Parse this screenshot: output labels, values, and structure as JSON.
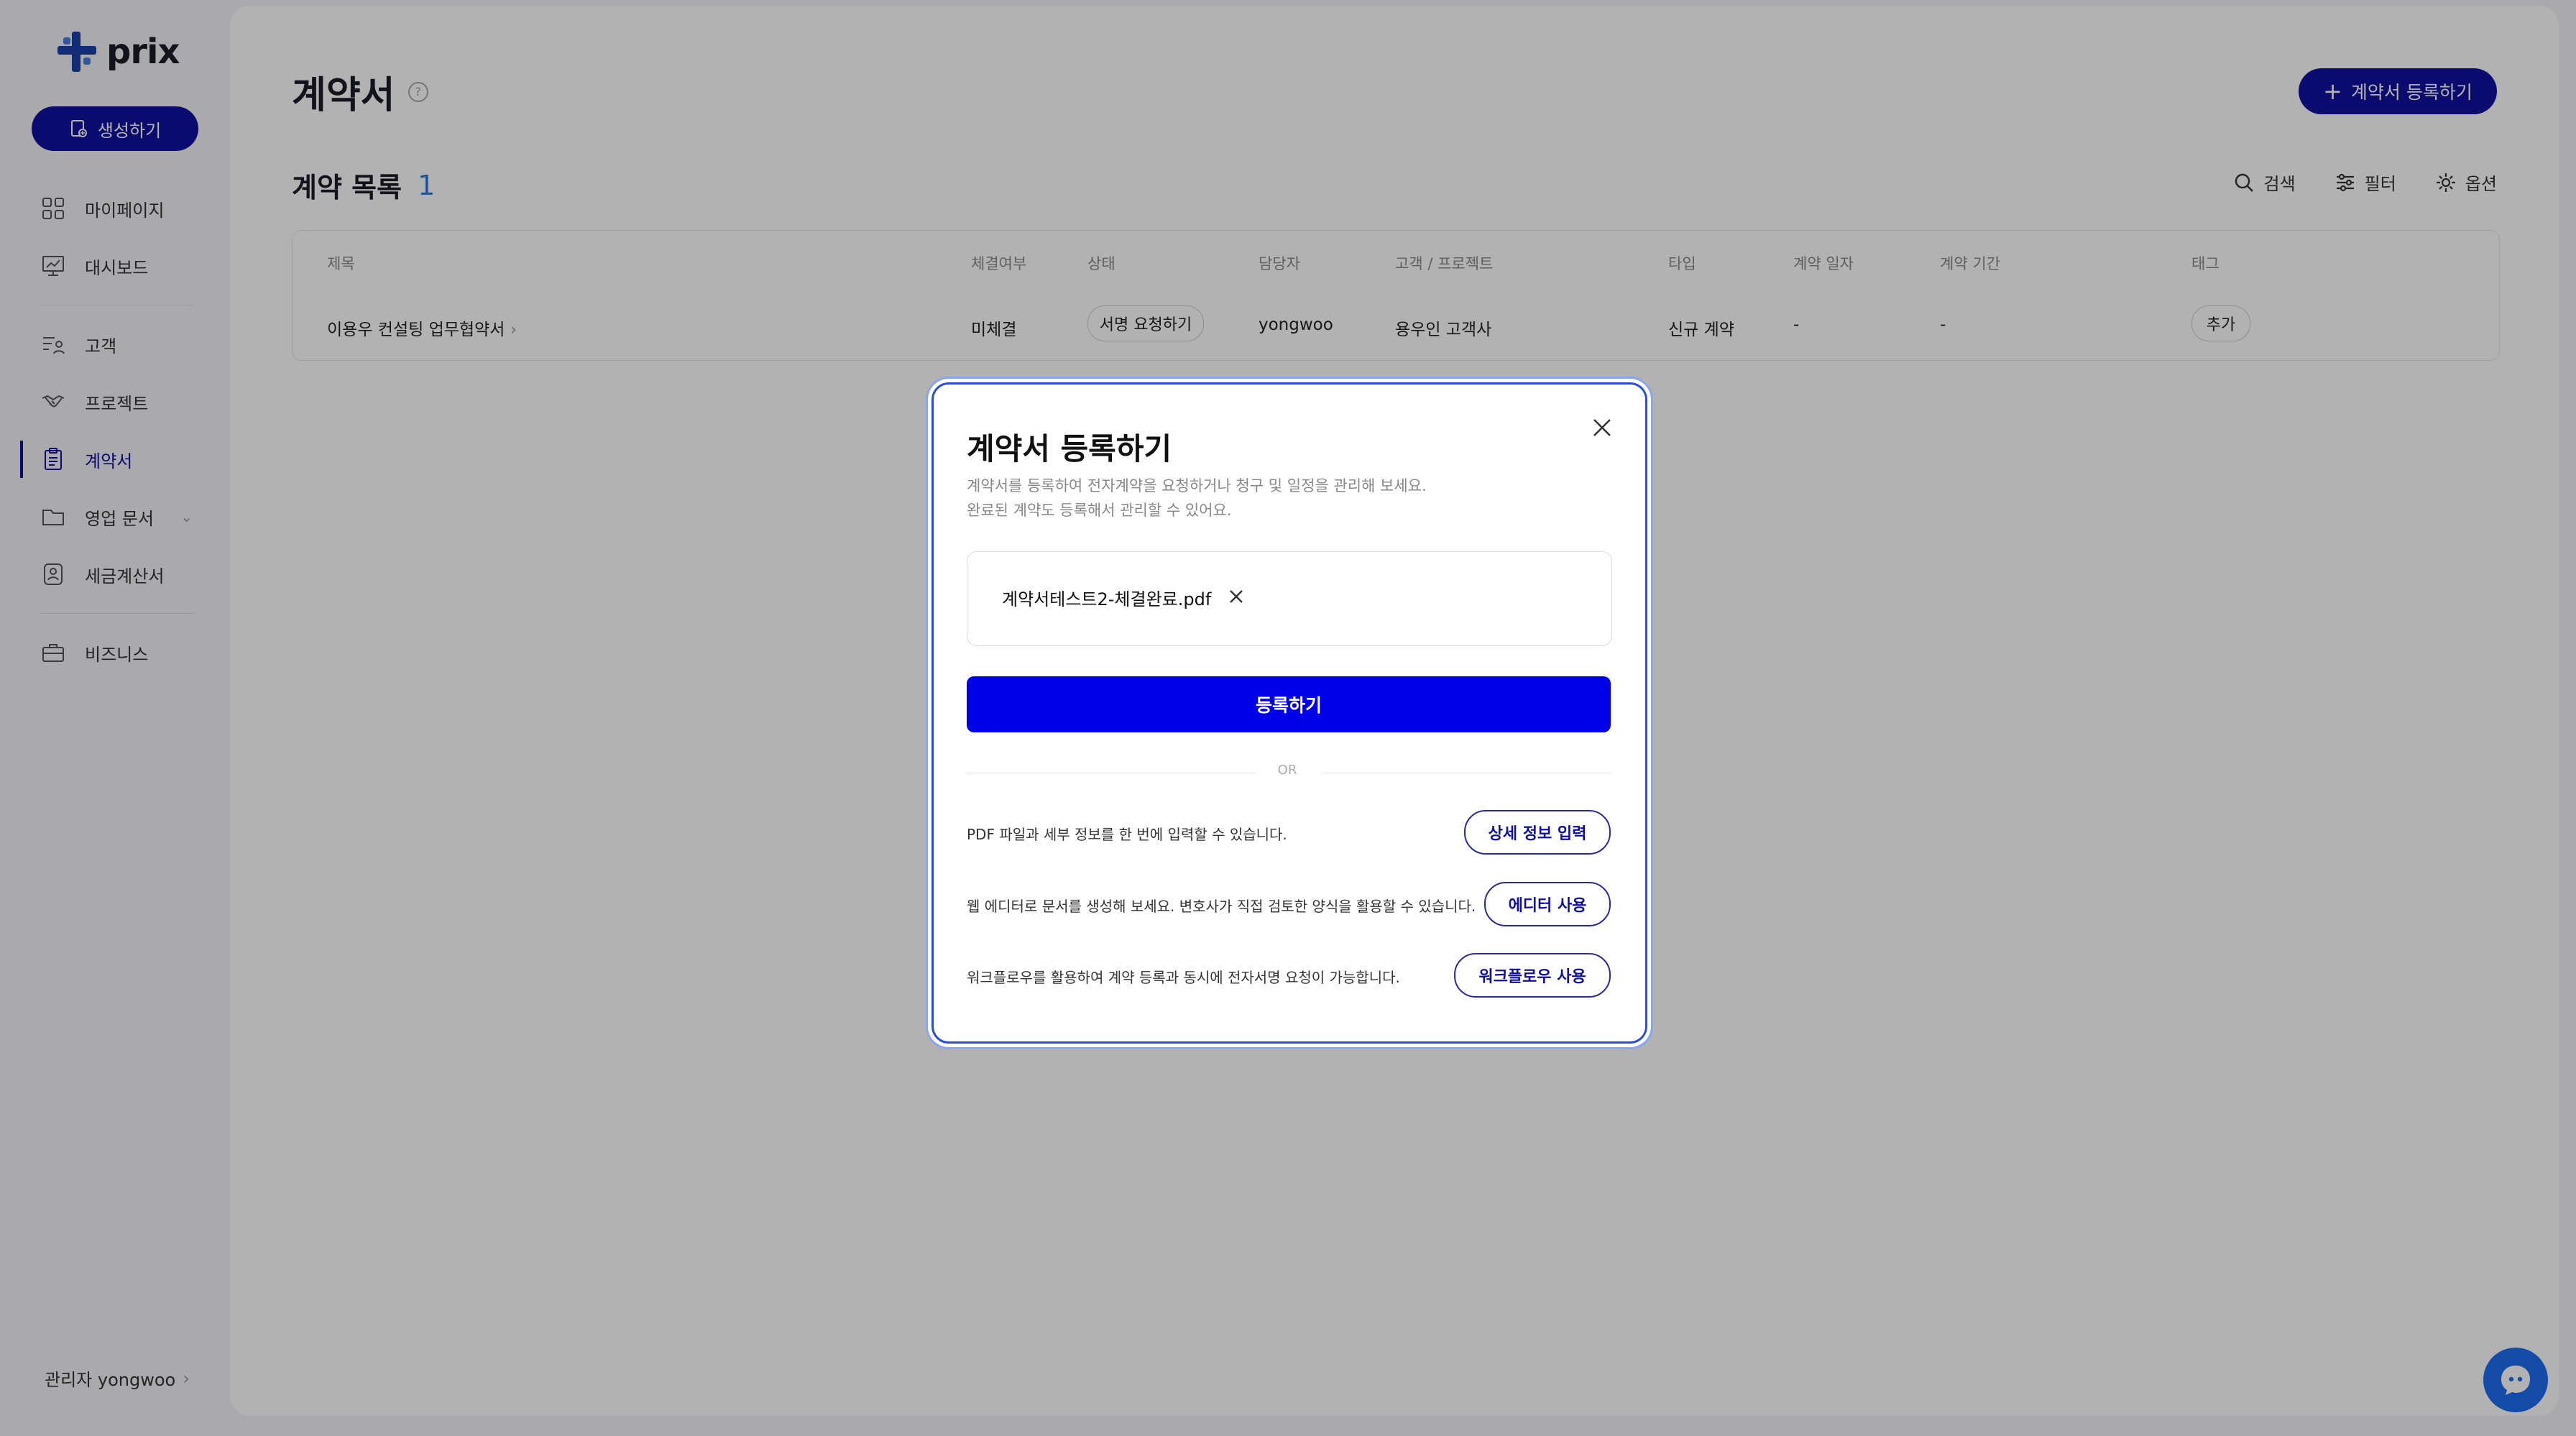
{
  "brand": {
    "name": "prix"
  },
  "sidebar": {
    "create_label": "생성하기",
    "items": [
      {
        "label": "마이페이지",
        "icon": "grid-icon"
      },
      {
        "label": "대시보드",
        "icon": "chart-board-icon"
      },
      {
        "label": "고객",
        "icon": "user-list-icon"
      },
      {
        "label": "프로젝트",
        "icon": "handshake-icon"
      },
      {
        "label": "계약서",
        "icon": "clipboard-icon"
      },
      {
        "label": "영업 문서",
        "icon": "folder-icon"
      },
      {
        "label": "세금계산서",
        "icon": "receipt-icon"
      },
      {
        "label": "비즈니스",
        "icon": "briefcase-icon"
      }
    ],
    "admin_label": "관리자 yongwoo"
  },
  "page": {
    "title": "계약서",
    "register_button": "계약서 등록하기",
    "list_title": "계약 목록",
    "list_count": "1",
    "tools": {
      "search": "검색",
      "filter": "필터",
      "options": "옵션"
    }
  },
  "table": {
    "headers": [
      "제목",
      "체결여부",
      "상태",
      "담당자",
      "고객 / 프로젝트",
      "타입",
      "계약 일자",
      "계약 기간",
      "태그"
    ],
    "rows": [
      {
        "title": "이용우 컨설팅 업무협약서",
        "signed": "미체결",
        "status": "서명 요청하기",
        "owner": "yongwoo",
        "client": "용우인 고객사",
        "type": "신규 계약",
        "date": "-",
        "period": "-",
        "tag": "추가"
      }
    ]
  },
  "modal": {
    "title": "계약서 등록하기",
    "desc_line1": "계약서를 등록하여 전자계약을 요청하거나 청구 및 일정을 관리해 보세요.",
    "desc_line2": "완료된 계약도 등록해서 관리할 수 있어요.",
    "file_name": "계약서테스트2-체결완료.pdf",
    "submit_label": "등록하기",
    "or_label": "OR",
    "options": [
      {
        "text": "PDF 파일과 세부 정보를 한 번에 입력할 수 있습니다.",
        "button": "상세 정보 입력"
      },
      {
        "text": "웹 에디터로 문서를 생성해 보세요. 변호사가 직접 검토한 양식을 활용할 수 있습니다.",
        "button": "에디터 사용"
      },
      {
        "text": "워크플로우를 활용하여 계약 등록과 동시에 전자서명 요청이 가능합니다.",
        "button": "워크플로우 사용"
      }
    ]
  },
  "colors": {
    "primary": "#1010a0",
    "submit_blue": "#0000e6",
    "count_blue": "#2e7bd6",
    "chat_blue": "#1c6cf0"
  }
}
